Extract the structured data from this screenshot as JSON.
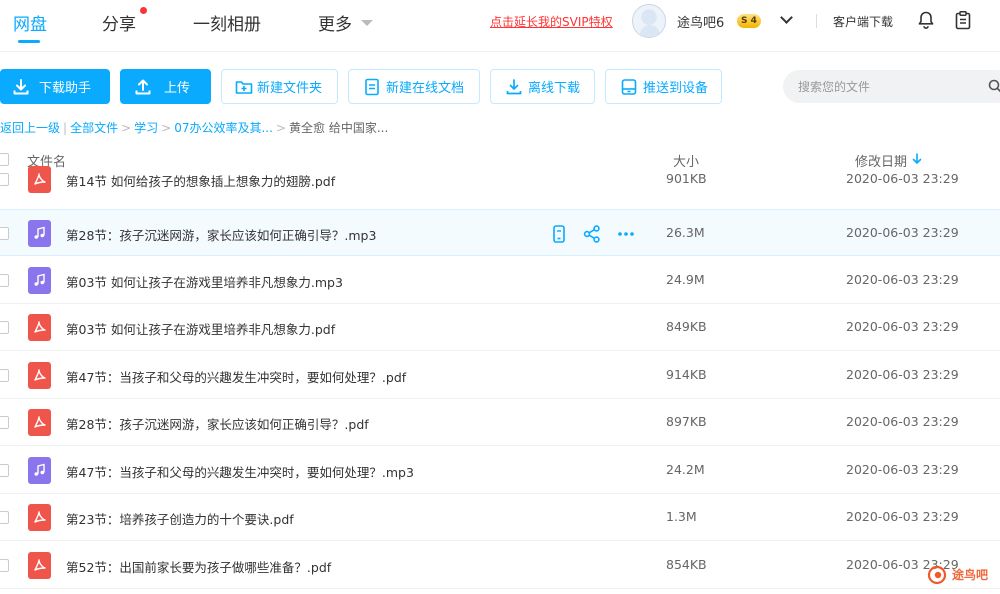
{
  "nav": {
    "tabs": [
      {
        "label": "网盘"
      },
      {
        "label": "分享"
      },
      {
        "label": "一刻相册"
      },
      {
        "label": "更多"
      }
    ],
    "svip_link": "点击延长我的SVIP特权",
    "username": "途鸟吧6",
    "vip_badge": "S  4",
    "client_download": "客户端下载"
  },
  "toolbar": {
    "download_helper": "下载助手",
    "upload": "上传",
    "new_folder": "新建文件夹",
    "new_online_doc": "新建在线文档",
    "offline_download": "离线下载",
    "push_to_device": "推送到设备",
    "search_placeholder": "搜索您的文件"
  },
  "breadcrumb": {
    "back": "返回上一级",
    "items": [
      "全部文件",
      "学习",
      "07办公效率及其..."
    ],
    "current": "黄全愈 给中国家..."
  },
  "list": {
    "headers": {
      "name": "文件名",
      "size": "大小",
      "date": "修改日期"
    },
    "rows": [
      {
        "type": "pdf",
        "name": "第14节 如何给孩子的想象插上想象力的翅膀.pdf",
        "size": "901KB",
        "date": "2020-06-03 23:29"
      },
      {
        "type": "mp3",
        "name": "第28节：孩子沉迷网游，家长应该如何正确引导？.mp3",
        "size": "26.3M",
        "date": "2020-06-03 23:29"
      },
      {
        "type": "mp3",
        "name": "第03节 如何让孩子在游戏里培养非凡想象力.mp3",
        "size": "24.9M",
        "date": "2020-06-03 23:29"
      },
      {
        "type": "pdf",
        "name": "第03节 如何让孩子在游戏里培养非凡想象力.pdf",
        "size": "849KB",
        "date": "2020-06-03 23:29"
      },
      {
        "type": "pdf",
        "name": "第47节：当孩子和父母的兴趣发生冲突时，要如何处理？.pdf",
        "size": "914KB",
        "date": "2020-06-03 23:29"
      },
      {
        "type": "pdf",
        "name": "第28节：孩子沉迷网游，家长应该如何正确引导？.pdf",
        "size": "897KB",
        "date": "2020-06-03 23:29"
      },
      {
        "type": "mp3",
        "name": "第47节：当孩子和父母的兴趣发生冲突时，要如何处理？.mp3",
        "size": "24.2M",
        "date": "2020-06-03 23:29"
      },
      {
        "type": "pdf",
        "name": "第23节：培养孩子创造力的十个要诀.pdf",
        "size": "1.3M",
        "date": "2020-06-03 23:29"
      },
      {
        "type": "pdf",
        "name": "第52节：出国前家长要为孩子做哪些准备？.pdf",
        "size": "854KB",
        "date": "2020-06-03 23:29"
      }
    ]
  },
  "watermark": "途鸟吧",
  "colors": {
    "accent": "#09aaff",
    "pdf": "#f0554c",
    "mp3": "#8b75ec",
    "alert": "#ff3333"
  }
}
